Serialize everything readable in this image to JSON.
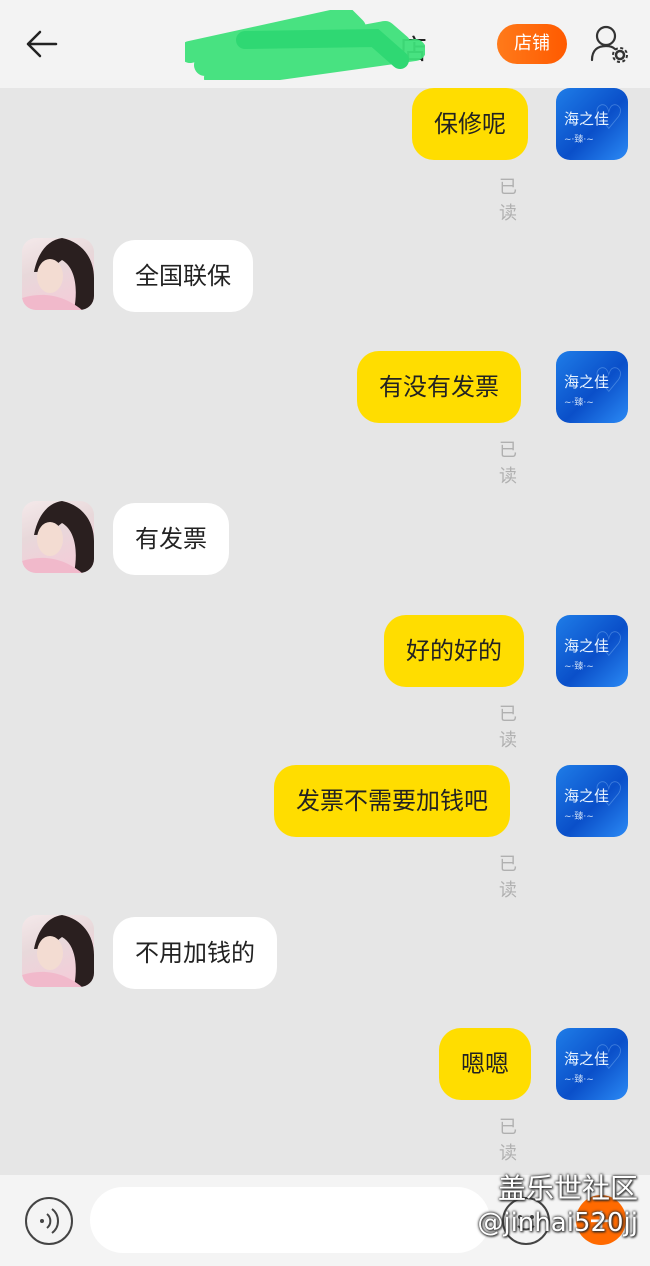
{
  "header": {
    "title_visible": "店",
    "shop_label": "店铺"
  },
  "messages": [
    {
      "side": "out",
      "text": "保修呢",
      "status": "已读"
    },
    {
      "side": "in",
      "text": "全国联保"
    },
    {
      "side": "out",
      "text": "有没有发票",
      "status": "已读"
    },
    {
      "side": "in",
      "text": "有发票"
    },
    {
      "side": "out",
      "text": "好的好的",
      "status": "已读"
    },
    {
      "side": "out",
      "text": "发票不需要加钱吧",
      "status": "已读"
    },
    {
      "side": "in",
      "text": "不用加钱的"
    },
    {
      "side": "out",
      "text": "嗯嗯",
      "status": "已读"
    }
  ],
  "shop_avatar": {
    "text": "海之佳",
    "sub": "~·臻·~"
  },
  "input": {
    "value": "",
    "placeholder": ""
  },
  "watermark": {
    "line1": "盖乐世社区",
    "line2": "@jinhai520jj"
  },
  "colors": {
    "outgoing_bubble": "#ffdd00",
    "incoming_bubble": "#ffffff",
    "accent": "#ff6a00",
    "background": "#e6e6e6"
  }
}
